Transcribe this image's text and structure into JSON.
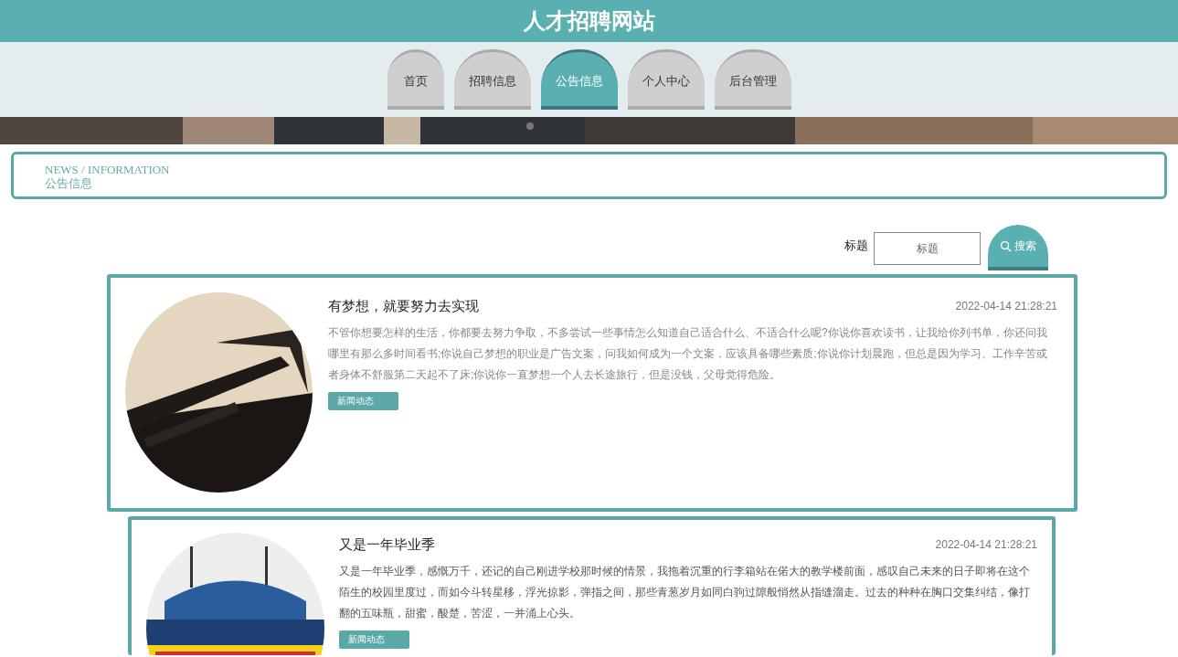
{
  "site_title": "人才招聘网站",
  "nav": [
    {
      "label": "首页",
      "selected": false
    },
    {
      "label": "招聘信息",
      "selected": false
    },
    {
      "label": "公告信息",
      "selected": true
    },
    {
      "label": "个人中心",
      "selected": false
    },
    {
      "label": "后台管理",
      "selected": false
    }
  ],
  "breadcrumb": {
    "english": "NEWS / INFORMATION",
    "title": "公告信息"
  },
  "search": {
    "label": "标题",
    "placeholder": "标题",
    "button": "搜索"
  },
  "news": [
    {
      "title": "有梦想，就要努力去实现",
      "time": "2022-04-14 21:28:21",
      "summary": "不管你想要怎样的生活，你都要去努力争取，不多尝试一些事情怎么知道自己适合什么、不适合什么呢?你说你喜欢读书，让我给你列书单，你还问我哪里有那么多时间看书;你说自己梦想的职业是广告文案，问我如何成为一个文案，应该具备哪些素质;你说你计划晨跑，但总是因为学习、工作辛苦或者身体不舒服第二天起不了床;你说你一直梦想一个人去长途旅行，但是没钱，父母觉得危险。",
      "tag": "新闻动态"
    },
    {
      "title": "又是一年毕业季",
      "time": "2022-04-14 21:28:21",
      "summary": "又是一年毕业季，感慨万千，还记的自己刚进学校那时候的情景，我拖着沉重的行李箱站在偌大的教学楼前面，感叹自己未来的日子即将在这个陌生的校园里度过，而如今斗转星移，浮光掠影，弹指之间，那些青葱岁月如同白驹过隙般悄然从指缝溜走。过去的种种在胸口交集纠结，像打翻的五味瓶，甜蜜，酸楚，苦涩，一并涌上心头。",
      "tag": "新闻动态"
    }
  ]
}
